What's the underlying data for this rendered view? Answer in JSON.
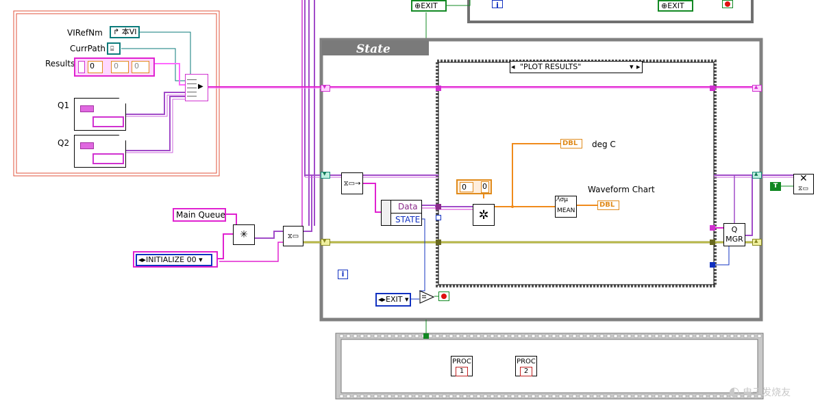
{
  "init_cluster": {
    "labels": {
      "vi_ref": "VIRefNm",
      "curr_path": "CurrPath",
      "results": "Results",
      "q1": "Q1",
      "q2": "Q2"
    },
    "vi_ref_value": "本VI",
    "results_values": [
      "0",
      "0",
      "0"
    ]
  },
  "main_queue": {
    "label": "Main Queue",
    "initial_state": "INITIALIZE 00"
  },
  "top_fragment": {
    "exit_left": "EXIT",
    "exit_right": "EXIT",
    "info": "i"
  },
  "state_loop": {
    "title": "State",
    "case_selector": "\"PLOT RESULTS\"",
    "unbundle": {
      "data": "Data",
      "state": "STATE"
    },
    "array_const": [
      "0",
      "0"
    ],
    "dbl_tag": "DBL",
    "mean_label": "MEAN",
    "indicators": {
      "deg_c": "deg C",
      "waveform_chart": "Waveform Chart"
    },
    "q_mgr": [
      "Q",
      "MGR"
    ],
    "exit_enum": "EXIT",
    "info": "i",
    "true_const": "T"
  },
  "proc_loop": {
    "proc1": [
      "PROC",
      "1"
    ],
    "proc2": [
      "PROC",
      "2"
    ]
  },
  "watermark": "电子发烧友"
}
